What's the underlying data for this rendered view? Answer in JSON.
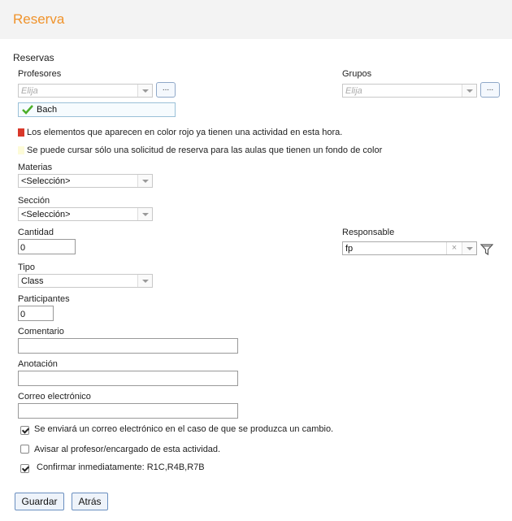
{
  "page": {
    "title": "Reserva"
  },
  "section": {
    "title": "Reservas"
  },
  "profesores": {
    "label": "Profesores",
    "placeholder": "Elija",
    "more_button": "...",
    "selected": "Bach"
  },
  "grupos": {
    "label": "Grupos",
    "placeholder": "Elija",
    "more_button": "..."
  },
  "legend": {
    "red_note": "Los elementos que aparecen en color rojo ya tienen una actividad en esta hora.",
    "red_color": "#d9382a",
    "yellow_note": "Se puede cursar sólo una solicitud de reserva para las aulas que tienen un fondo de color",
    "yellow_color": "#fdfbd8"
  },
  "materias": {
    "label": "Materias",
    "value": "<Selección>"
  },
  "seccion": {
    "label": "Sección",
    "value": "<Selección>"
  },
  "cantidad": {
    "label": "Cantidad",
    "value": "0"
  },
  "responsable": {
    "label": "Responsable",
    "value": "fp",
    "clear": "×"
  },
  "tipo": {
    "label": "Tipo",
    "value": "Class"
  },
  "participantes": {
    "label": "Participantes",
    "value": "0"
  },
  "comentario": {
    "label": "Comentario",
    "value": ""
  },
  "anotacion": {
    "label": "Anotación",
    "value": ""
  },
  "correo": {
    "label": "Correo electrónico",
    "value": ""
  },
  "options": {
    "email_change": {
      "label": "Se enviará un correo electrónico en el caso de que se produzca un cambio.",
      "checked": true
    },
    "notify_teacher": {
      "label": "Avisar al profesor/encargado de esta actividad.",
      "checked": false
    },
    "confirm_now": {
      "label": "Confirmar inmediatamente: R1C,R4B,R7B",
      "checked": true
    }
  },
  "buttons": {
    "save": "Guardar",
    "back": "Atrás"
  },
  "colors": {
    "accent": "#f0932b",
    "header_bg": "#f3f3f3",
    "check_green": "#4caf2a"
  }
}
